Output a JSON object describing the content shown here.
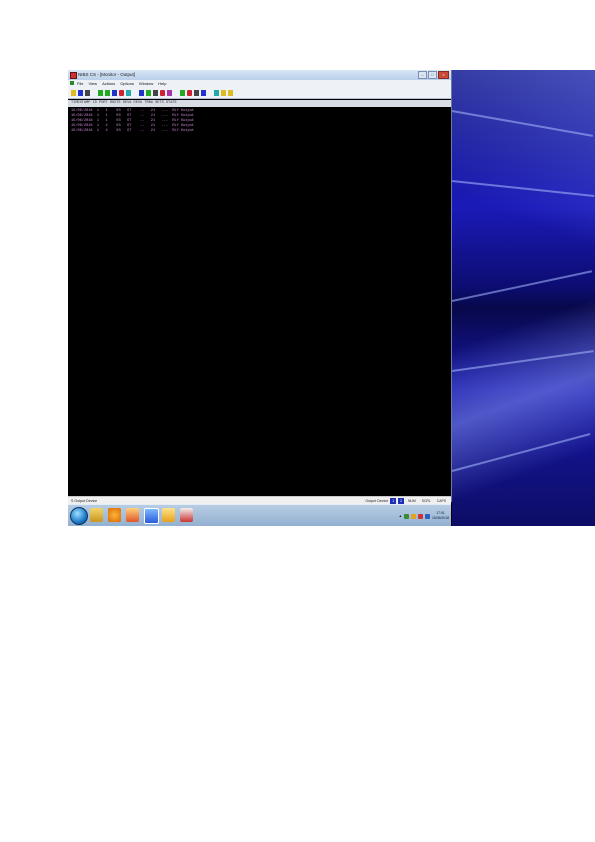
{
  "window": {
    "title": "NIBS CS - [Monitor - Output]",
    "menu": [
      "File",
      "View",
      "Actions",
      "Options",
      "Window",
      "Help"
    ],
    "controls": [
      "minimize-icon",
      "maximize-icon",
      "close-icon"
    ]
  },
  "toolbar": {
    "icons": [
      "open-icon",
      "save-icon",
      "print-icon",
      "connect-icon",
      "disconnect-icon",
      "monitor-icon",
      "output-icon",
      "input-icon",
      "relay-icon",
      "zone-icon",
      "camera-icon",
      "door-icon",
      "alarm-icon",
      "arm-icon",
      "disarm-icon",
      "cancel-icon",
      "report-icon",
      "settings-icon",
      "info-icon",
      "help-icon"
    ]
  },
  "log": {
    "header": "TIMESTAMP  ID  PORT  ROUTE  DEV#  DEV#  TRB#  SETS  STATE",
    "rows": [
      "15/06/2018  1   1    03   OT    --   21   ---  RLY Output",
      "15/06/2018  1   1    03   OT    --   21   ---  RLY Output",
      "15/06/2018  1   1    03   OT    --   21   ---  RLY Output",
      "15/06/2018  1   4    03   OT    --   21   ---  RLY Output",
      "15/06/2018  1   4    03   OT    --   21   ---  RLY Output"
    ]
  },
  "status": {
    "left": "S Output Device",
    "right_label": "Output Device",
    "boxes": [
      "1",
      "2",
      "NUM",
      "SCRL",
      "CAPS"
    ]
  },
  "taskbar": {
    "icons": [
      "start-orb-icon",
      "explorer-icon",
      "media-icon",
      "paint-icon",
      "app-icon",
      "security-icon",
      "printer-icon"
    ],
    "tray_icons": [
      "chevron-up-icon",
      "network-icon",
      "volume-icon",
      "flag-icon",
      "battery-icon"
    ],
    "time": "17:51",
    "date": "15/06/2018"
  },
  "colors": {
    "console_bg": "#000000",
    "log_text": "#d08cd8",
    "titlebar": "#c8dbf0",
    "taskbar": "#a5bfdc",
    "wallpaper": "#1a1ab8"
  }
}
